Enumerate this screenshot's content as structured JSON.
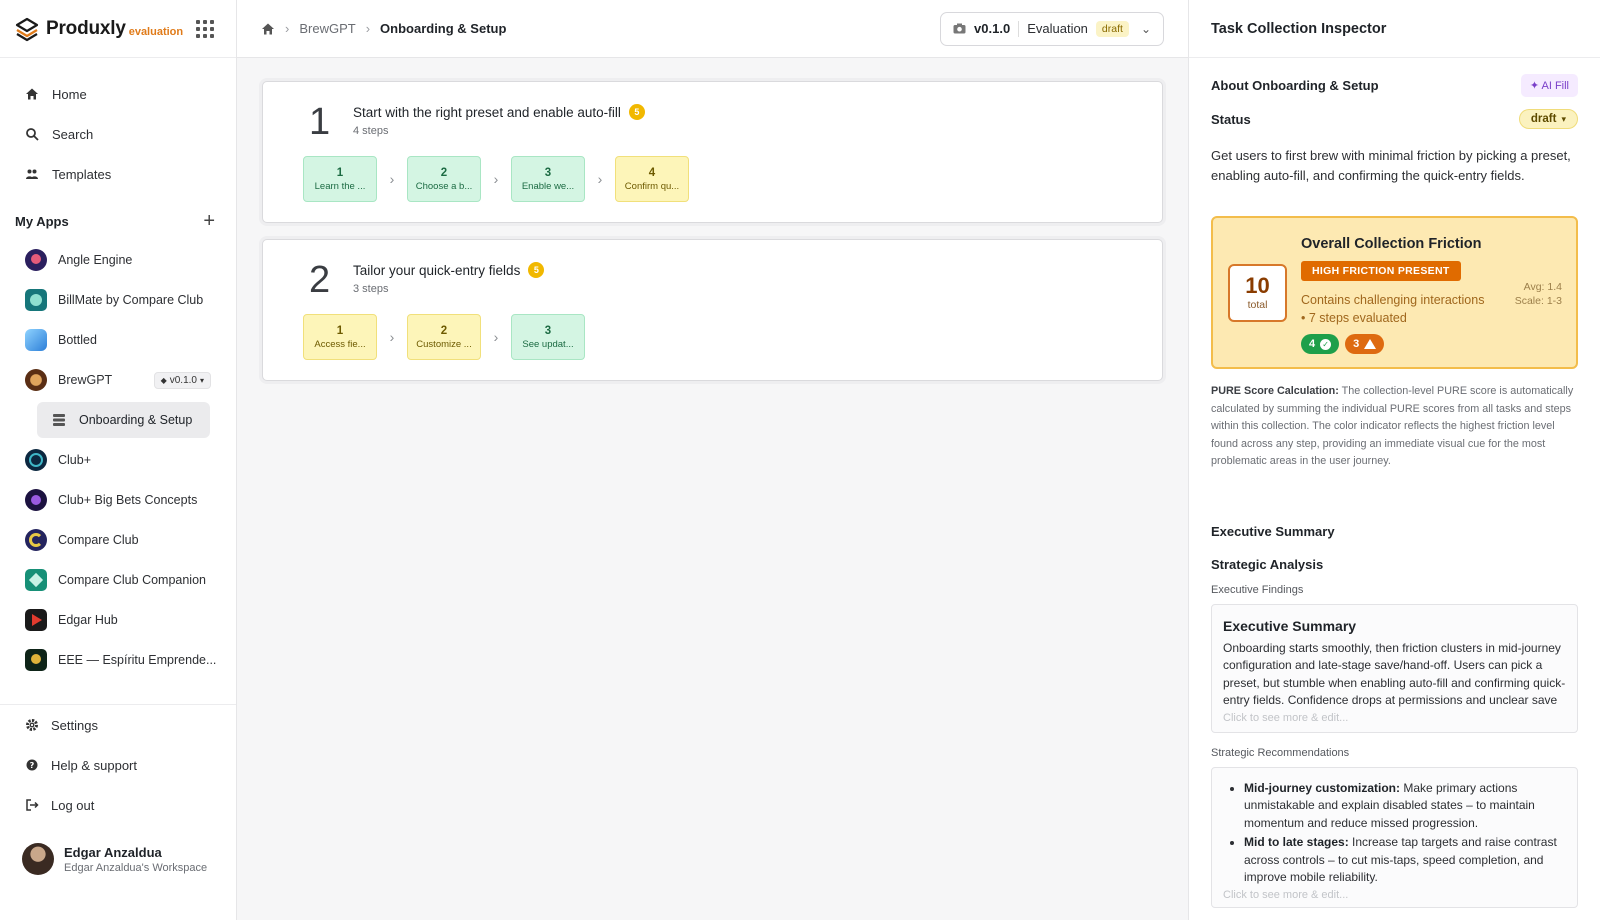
{
  "brand": {
    "name": "Produxly",
    "sub": "evaluation"
  },
  "nav": [
    {
      "label": "Home",
      "icon": "home-icon"
    },
    {
      "label": "Search",
      "icon": "search-icon"
    },
    {
      "label": "Templates",
      "icon": "people-icon"
    }
  ],
  "my_apps": {
    "title": "My Apps",
    "items": [
      {
        "label": "Angle Engine",
        "color": "#3b2b7a"
      },
      {
        "label": "BillMate by Compare Club",
        "color": "#1f7a7a"
      },
      {
        "label": "Bottled",
        "color": "#3aa0e8"
      },
      {
        "label": "BrewGPT",
        "color": "#6b3b1e",
        "version": "v0.1.0"
      },
      {
        "label": "Club+",
        "color": "#0d2a44"
      },
      {
        "label": "Club+ Big Bets Concepts",
        "color": "#2a1b4e"
      },
      {
        "label": "Compare Club",
        "color": "#2a2a66"
      },
      {
        "label": "Compare Club Companion",
        "color": "#1c8a74"
      },
      {
        "label": "Edgar Hub",
        "color": "#d4372d"
      },
      {
        "label": "EEE — Espíritu Emprende...",
        "color": "#0f2a1a"
      }
    ],
    "sub_item": "Onboarding & Setup"
  },
  "bottom_nav": [
    {
      "label": "Settings",
      "icon": "gear-icon"
    },
    {
      "label": "Help & support",
      "icon": "help-icon"
    },
    {
      "label": "Log out",
      "icon": "logout-icon"
    }
  ],
  "user": {
    "name": "Edgar Anzaldua",
    "workspace": "Edgar Anzaldua's Workspace"
  },
  "breadcrumb": {
    "app": "BrewGPT",
    "current": "Onboarding & Setup"
  },
  "version_select": {
    "version": "v0.1.0",
    "mode": "Evaluation",
    "status": "draft"
  },
  "tasks": [
    {
      "num": "1",
      "title": "Start with the right preset and enable auto-fill",
      "badge": "5",
      "steps_count": "4 steps",
      "steps": [
        {
          "n": "1",
          "label": "Learn the ...",
          "tone": "green"
        },
        {
          "n": "2",
          "label": "Choose a b...",
          "tone": "green"
        },
        {
          "n": "3",
          "label": "Enable we...",
          "tone": "green"
        },
        {
          "n": "4",
          "label": "Confirm qu...",
          "tone": "yellow"
        }
      ]
    },
    {
      "num": "2",
      "title": "Tailor your quick-entry fields",
      "badge": "5",
      "steps_count": "3 steps",
      "steps": [
        {
          "n": "1",
          "label": "Access fie...",
          "tone": "yellow"
        },
        {
          "n": "2",
          "label": "Customize ...",
          "tone": "yellow"
        },
        {
          "n": "3",
          "label": "See updat...",
          "tone": "green"
        }
      ]
    }
  ],
  "panel": {
    "title": "Task Collection Inspector",
    "about": "About Onboarding & Setup",
    "ai_fill": "AI Fill",
    "status_label": "Status",
    "status_value": "draft",
    "description": "Get users to first brew with minimal friction by picking a preset, enabling auto-fill, and confirming the quick-entry fields.",
    "friction": {
      "score": "10",
      "score_label": "total",
      "title": "Overall Collection Friction",
      "tag": "HIGH FRICTION PRESENT",
      "line1": "Contains challenging interactions",
      "line2": "• 7 steps evaluated",
      "avg": "Avg: 1.4",
      "scale": "Scale: 1-3",
      "good_count": "4",
      "warn_count": "3"
    },
    "calc_label": "PURE Score Calculation:",
    "calc_text": " The collection-level PURE score is automatically calculated by summing the individual PURE scores from all tasks and steps within this collection. The color indicator reflects the highest friction level found across any step, providing an immediate visual cue for the most problematic areas in the user journey.",
    "exec_heading": "Executive Summary",
    "strat_heading": "Strategic Analysis",
    "findings_label": "Executive Findings",
    "findings_title": "Executive Summary",
    "findings_text": "Onboarding starts smoothly, then friction clusters in mid-journey configuration and late-stage save/hand-off. Users can pick a preset, but stumble when enabling auto-fill and confirming quick-entry fields. Confidence drops at permissions and unclear save states.",
    "more_hint": "Click to see more & edit...",
    "recs_label": "Strategic Recommendations",
    "recs": [
      {
        "bold": "Mid-journey customization:",
        "text": " Make primary actions unmistakable and explain disabled states – to maintain momentum and reduce missed progression."
      },
      {
        "bold": "Mid to late stages:",
        "text": " Increase tap targets and raise contrast across controls – to cut mis-taps, speed completion, and improve mobile reliability."
      }
    ]
  }
}
